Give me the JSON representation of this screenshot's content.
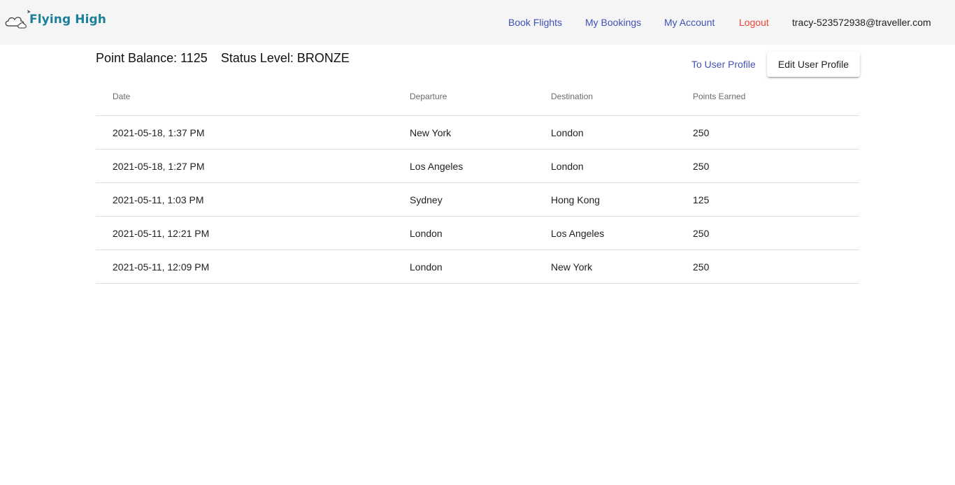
{
  "header": {
    "logo_text": "Flying High",
    "nav": {
      "book_flights": "Book Flights",
      "my_bookings": "My Bookings",
      "my_account": "My Account",
      "logout": "Logout"
    },
    "user_email": "tracy-523572938@traveller.com",
    "colors": {
      "nav_link": "#3f51b5",
      "logout": "#f44336",
      "logo": "#1b7f98"
    }
  },
  "summary": {
    "point_balance": "Point Balance: 1125",
    "status_level": "Status Level: BRONZE"
  },
  "actions": {
    "to_user_profile": "To User Profile",
    "edit_user_profile": "Edit User Profile"
  },
  "table": {
    "columns": {
      "date": "Date",
      "departure": "Departure",
      "destination": "Destination",
      "points_earned": "Points Earned"
    },
    "rows": [
      {
        "date": "2021-05-18, 1:37 PM",
        "departure": "New York",
        "destination": "London",
        "points": "250"
      },
      {
        "date": "2021-05-18, 1:27 PM",
        "departure": "Los Angeles",
        "destination": "London",
        "points": "250"
      },
      {
        "date": "2021-05-11, 1:03 PM",
        "departure": "Sydney",
        "destination": "Hong Kong",
        "points": "125"
      },
      {
        "date": "2021-05-11, 12:21 PM",
        "departure": "London",
        "destination": "Los Angeles",
        "points": "250"
      },
      {
        "date": "2021-05-11, 12:09 PM",
        "departure": "London",
        "destination": "New York",
        "points": "250"
      }
    ]
  }
}
